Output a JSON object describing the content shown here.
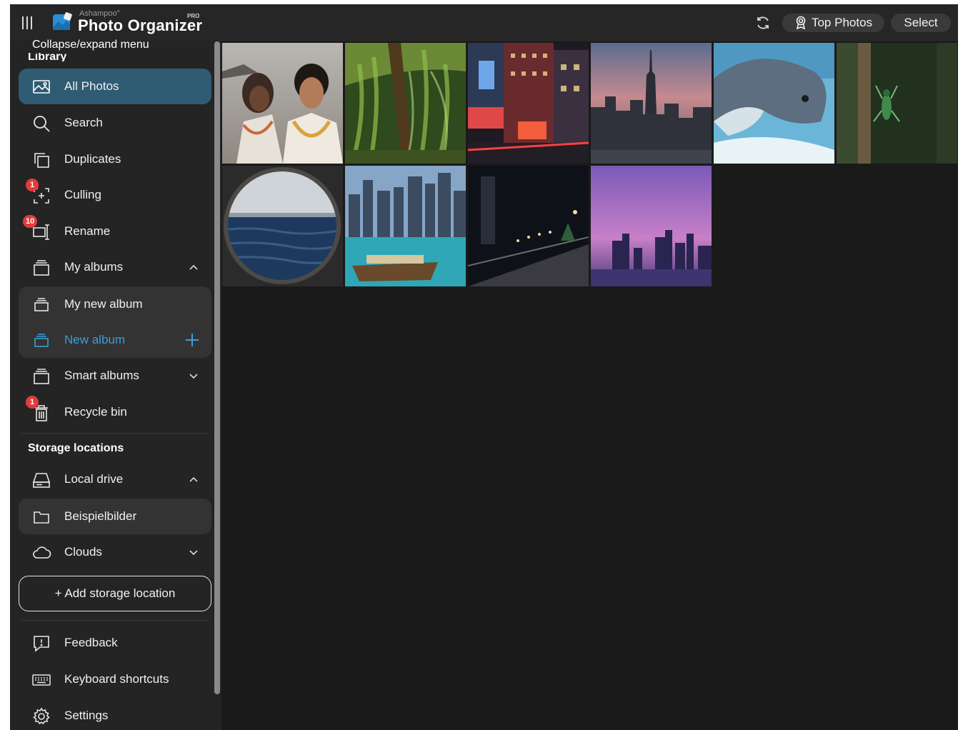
{
  "header": {
    "brand_small": "Ashampoo°",
    "brand_pro": "PRO",
    "brand_title": "Photo Organizer",
    "tooltip": "Collapse/expand menu",
    "top_photos_label": "Top Photos",
    "select_label": "Select"
  },
  "sidebar": {
    "library_heading": "Library",
    "items": {
      "all_photos": "All Photos",
      "search": "Search",
      "duplicates": "Duplicates",
      "culling": "Culling",
      "culling_badge": "1",
      "rename": "Rename",
      "rename_badge": "10",
      "my_albums": "My albums",
      "my_new_album": "My new album",
      "new_album": "New album",
      "smart_albums": "Smart albums",
      "recycle_bin": "Recycle bin",
      "recycle_badge": "1"
    },
    "storage_heading": "Storage locations",
    "storage": {
      "local_drive": "Local drive",
      "beispielbilder": "Beispielbilder",
      "clouds": "Clouds",
      "add_storage": "+ Add storage location"
    },
    "footer": {
      "feedback": "Feedback",
      "keyboard_shortcuts": "Keyboard shortcuts",
      "settings": "Settings"
    }
  },
  "photos": [
    {
      "subject": "couple-on-beach"
    },
    {
      "subject": "forest-willow"
    },
    {
      "subject": "times-square-night"
    },
    {
      "subject": "new-york-skyline-dusk"
    },
    {
      "subject": "dolphin"
    },
    {
      "subject": "green-insect-on-bark"
    },
    {
      "subject": "sea-through-porthole"
    },
    {
      "subject": "dubai-marina-boat"
    },
    {
      "subject": "city-promenade-night"
    },
    {
      "subject": "purple-skyline"
    }
  ],
  "colors": {
    "accent": "#2f5b73",
    "accent_text": "#3aa0d8",
    "badge": "#e23b3b",
    "background": "#1c1c1c",
    "sidebar": "#242424"
  }
}
